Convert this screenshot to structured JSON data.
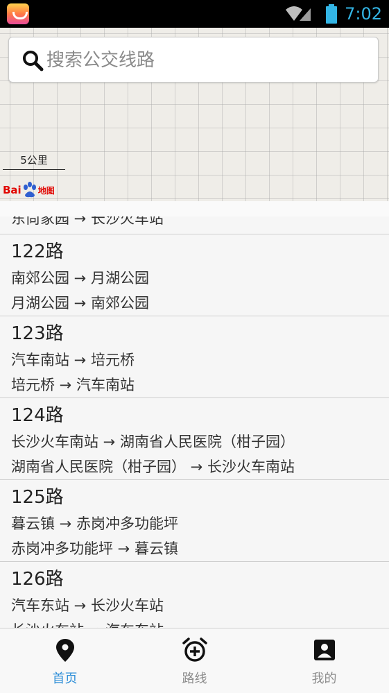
{
  "status_bar": {
    "time": "7:02",
    "icons": [
      "app-icon",
      "wifi-icon",
      "signal-icon",
      "battery-icon"
    ]
  },
  "search": {
    "placeholder": "搜索公交线路",
    "icon": "search-icon"
  },
  "map": {
    "scale_label": "5公里",
    "logo_text_left": "Bai",
    "logo_text_right": "地图"
  },
  "routes": [
    {
      "name": "",
      "dir_a": "东尚家园 → 长沙火车站",
      "dir_b": ""
    },
    {
      "name": "122路",
      "dir_a": "南郊公园 → 月湖公园",
      "dir_b": "月湖公园 → 南郊公园"
    },
    {
      "name": "123路",
      "dir_a": "汽车南站 → 培元桥",
      "dir_b": "培元桥 → 汽车南站"
    },
    {
      "name": "124路",
      "dir_a": "长沙火车南站 → 湖南省人民医院（柑子园）",
      "dir_b": "湖南省人民医院（柑子园） → 长沙火车南站"
    },
    {
      "name": "125路",
      "dir_a": "暮云镇 → 赤岗冲多功能坪",
      "dir_b": "赤岗冲多功能坪 → 暮云镇"
    },
    {
      "name": "126路",
      "dir_a": "汽车东站 → 长沙火车站",
      "dir_b": "长沙火车站 → 汽车东站"
    }
  ],
  "nav": {
    "home": "首页",
    "routes": "路线",
    "mine": "我的"
  },
  "colors": {
    "accent": "#2f8fd8",
    "status_time": "#33b5e5",
    "baidu_red": "#e10601"
  }
}
